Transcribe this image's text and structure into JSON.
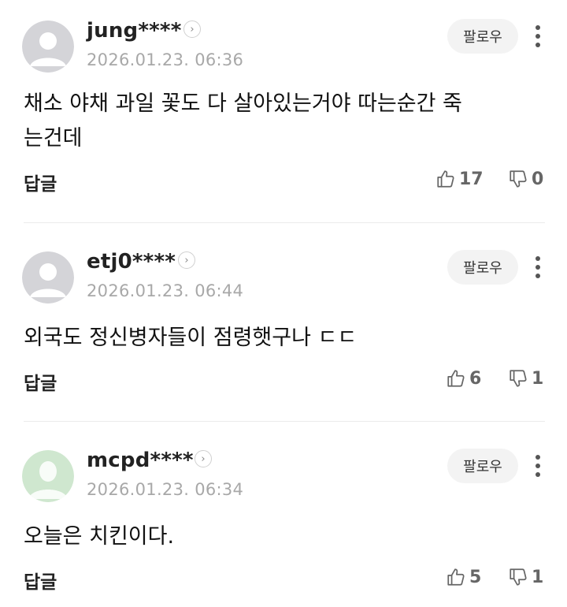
{
  "follow_label": "팔로우",
  "reply_label": "답글",
  "profile_arrow_glyph": "›",
  "comments": [
    {
      "username": "jung****",
      "timestamp": "2026.01.23. 06:36",
      "avatar_icon": "default-avatar-icon",
      "content": "채소 야채 과일 꽃도 다 살아있는거야 따는순간 죽\n는건데",
      "likes": "17",
      "dislikes": "0"
    },
    {
      "username": "etj0****",
      "timestamp": "2026.01.23. 06:44",
      "avatar_icon": "default-avatar-icon",
      "content": "외국도 정신병자들이 점령햇구나 ㄷㄷ",
      "likes": "6",
      "dislikes": "1"
    },
    {
      "username": "mcpd****",
      "timestamp": "2026.01.23. 06:34",
      "avatar_icon": "silhouette-avatar-icon",
      "content": "오늘은 치킨이다.",
      "likes": "5",
      "dislikes": "1"
    }
  ],
  "colors": {
    "text": "#111111",
    "timestamp": "#a8a8a8",
    "follow_bg": "#f3f3f3",
    "divider": "#ebebeb",
    "avatar_gray": "#d4d4d8",
    "avatar_green": "#cfe7cf"
  }
}
